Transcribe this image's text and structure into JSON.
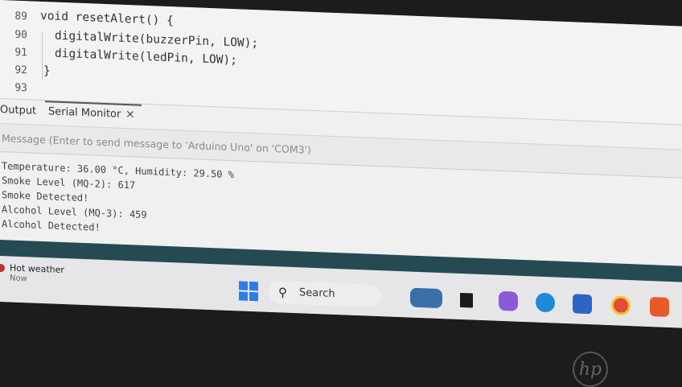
{
  "editor": {
    "lines": [
      {
        "number": "89",
        "code": "void resetAlert() {"
      },
      {
        "number": "90",
        "code": "digitalWrite(buzzerPin, LOW);"
      },
      {
        "number": "91",
        "code": "digitalWrite(ledPin, LOW);"
      },
      {
        "number": "92",
        "code": "}"
      },
      {
        "number": "93",
        "code": ""
      }
    ]
  },
  "panel": {
    "tabs": [
      {
        "label": "Output"
      },
      {
        "label": "Serial Monitor"
      }
    ],
    "close_symbol": "×"
  },
  "message": {
    "placeholder": "Message (Enter to send message to 'Arduino Uno' on 'COM3')"
  },
  "serial_output": [
    "Temperature: 36.00 °C, Humidity: 29.50 %",
    "Smoke Level (MQ-2): 617",
    "Smoke Detected!",
    "Alcohol Level (MQ-3): 459",
    "Alcohol Detected!"
  ],
  "taskbar": {
    "weather": {
      "title": "Hot weather",
      "subtitle": "Now"
    },
    "search_label": "Search",
    "apps": [
      {
        "icon": "photos-icon",
        "color": "#3b6fa8"
      },
      {
        "icon": "file-explorer-icon",
        "color": "#1a1a1a"
      },
      {
        "icon": "copilot-icon",
        "color": "#8a5bd6"
      },
      {
        "icon": "edge-icon",
        "color": "#1f8ad6"
      },
      {
        "icon": "store-icon",
        "color": "#2a66c8"
      },
      {
        "icon": "chrome-icon",
        "color": "#e24b3a"
      },
      {
        "icon": "brave-icon",
        "color": "#e85a2a"
      }
    ]
  },
  "bezel": {
    "logo": "hp"
  }
}
